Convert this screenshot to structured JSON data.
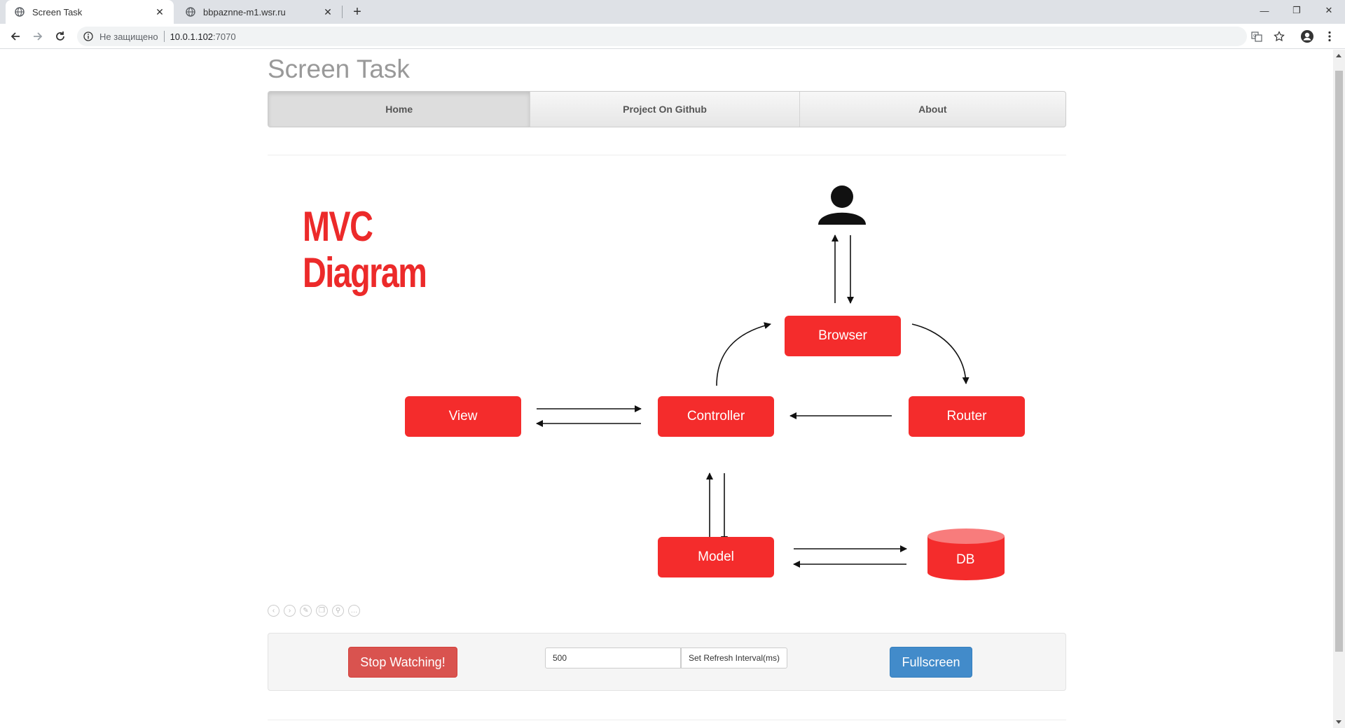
{
  "tabs": [
    {
      "title": "Screen Task",
      "active": true
    },
    {
      "title": "bbpaznne-m1.wsr.ru",
      "active": false
    }
  ],
  "address": {
    "security_label": "Не защищено",
    "host": "10.0.1.102",
    "port": ":7070"
  },
  "page": {
    "site_title": "Screen Task",
    "nav": [
      {
        "label": "Home",
        "active": true
      },
      {
        "label": "Project On Github",
        "active": false
      },
      {
        "label": "About",
        "active": false
      }
    ]
  },
  "diagram": {
    "title_line1": "MVC",
    "title_line2": "Diagram",
    "nodes": {
      "browser": "Browser",
      "view": "View",
      "controller": "Controller",
      "router": "Router",
      "model": "Model",
      "db": "DB"
    },
    "colors": {
      "node": "#f42c2c",
      "title": "#ec2a2a"
    }
  },
  "controls": {
    "stop_label": "Stop Watching!",
    "interval_value": "500",
    "set_interval_label": "Set Refresh Interval(ms)",
    "fullscreen_label": "Fullscreen"
  },
  "icons": [
    "globe-icon",
    "close-icon",
    "back-icon",
    "forward-icon",
    "reload-icon",
    "info-icon",
    "translate-icon",
    "star-icon",
    "profile-icon",
    "menu-icon",
    "user-icon"
  ]
}
